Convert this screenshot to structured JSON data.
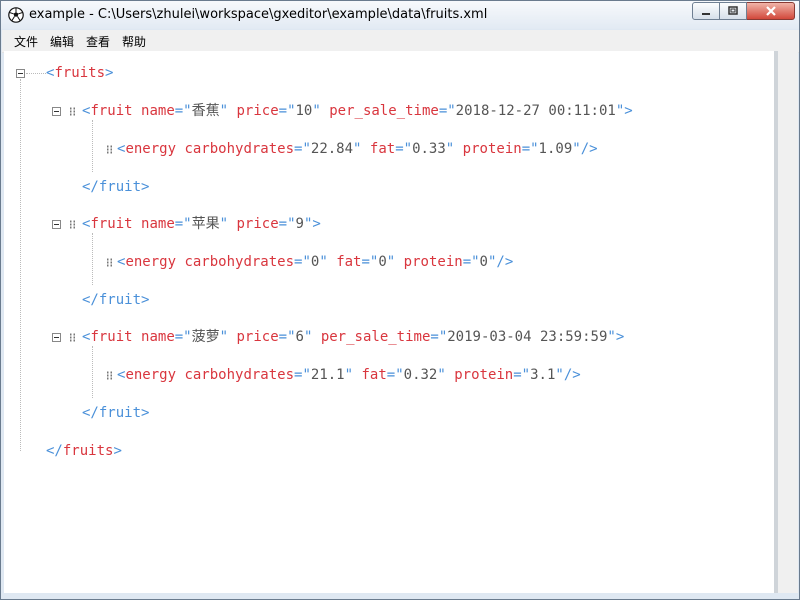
{
  "window": {
    "title": "example - C:\\Users\\zhulei\\workspace\\gxeditor\\example\\data\\fruits.xml",
    "icon": "soccer-ball-icon"
  },
  "menu": [
    "文件",
    "编辑",
    "查看",
    "帮助"
  ],
  "xml": {
    "root_tag": "fruits",
    "fruits": [
      {
        "attrs": [
          [
            "name",
            "香蕉"
          ],
          [
            "price",
            "10"
          ],
          [
            "per_sale_time",
            "2018-12-27 00:11:01"
          ]
        ],
        "energy": [
          [
            "carbohydrates",
            "22.84"
          ],
          [
            "fat",
            "0.33"
          ],
          [
            "protein",
            "1.09"
          ]
        ]
      },
      {
        "attrs": [
          [
            "name",
            "苹果"
          ],
          [
            "price",
            "9"
          ]
        ],
        "energy": [
          [
            "carbohydrates",
            "0"
          ],
          [
            "fat",
            "0"
          ],
          [
            "protein",
            "0"
          ]
        ]
      },
      {
        "attrs": [
          [
            "name",
            "菠萝"
          ],
          [
            "price",
            "6"
          ],
          [
            "per_sale_time",
            "2019-03-04 23:59:59"
          ]
        ],
        "energy": [
          [
            "carbohydrates",
            "21.1"
          ],
          [
            "fat",
            "0.32"
          ],
          [
            "protein",
            "3.1"
          ]
        ]
      }
    ],
    "child_tag": "fruit",
    "leaf_tag": "energy"
  }
}
